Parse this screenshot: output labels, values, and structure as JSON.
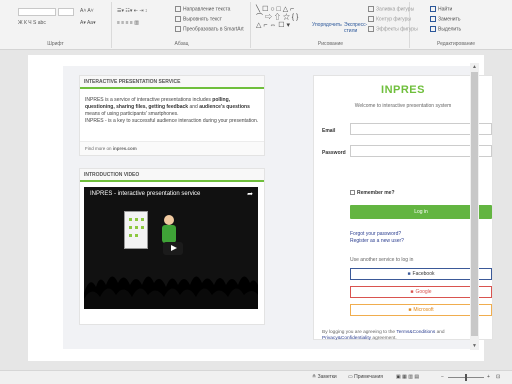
{
  "ribbon": {
    "font_group_label": "Шрифт",
    "paragraph_group_label": "Абзац",
    "drawing_group_label": "Рисование",
    "editing_group_label": "Редактирование",
    "text_direction": "Направление текста",
    "align_text": "Выровнять текст",
    "convert_smartart": "Преобразовать в SmartArt",
    "arrange": "Упорядочить",
    "express_styles": "Экспресс-стили",
    "shape_fill": "Заливка фигуры",
    "shape_outline": "Контур фигуры",
    "shape_effects": "Эффекты фигуры",
    "find": "Найти",
    "replace": "Заменить",
    "select": "Выделить"
  },
  "left_panel": {
    "about_title": "INTERACTIVE PRESENTATION SERVICE",
    "about_p1_prefix": "INPRES is a service of interactive presentations includes ",
    "about_p1_bold": "polling, questioning, sharing files, getting feedback",
    "about_p1_mid": " and ",
    "about_p1_bold2": "audience's questions",
    "about_p1_suffix": " means of using participants' smartphones.",
    "about_p2": "INPRES - is a key to successful audience interaction during your presentation.",
    "find_more_prefix": "Find more on ",
    "find_more_link": "inpres.com",
    "video_title_header": "INTRODUCTION VIDEO",
    "video_title": "INPRES - interactive presentation service"
  },
  "login": {
    "logo": "INPRES",
    "welcome": "Welcome to interactive presentation system",
    "email_label": "Email",
    "password_label": "Password",
    "remember": "Remember me?",
    "login_button": "Log in",
    "forgot": "Forgot your password?",
    "register": "Register as a new user?",
    "other_service": "Use another service to log in",
    "facebook": "Facebook",
    "google": "Google",
    "microsoft": "Microsoft",
    "terms_prefix": "By logging you are agreeing to the ",
    "terms_link": "Terms&Conditions",
    "terms_mid": " and ",
    "privacy_link": "Privacy&Confidentiality",
    "terms_suffix": " agreement."
  },
  "status": {
    "notes": "Заметки",
    "comments": "Примечания"
  },
  "colors": {
    "accent_green": "#6fbf3c",
    "facebook": "#3b5998",
    "google": "#d9534f",
    "microsoft": "#f0ad4e"
  }
}
